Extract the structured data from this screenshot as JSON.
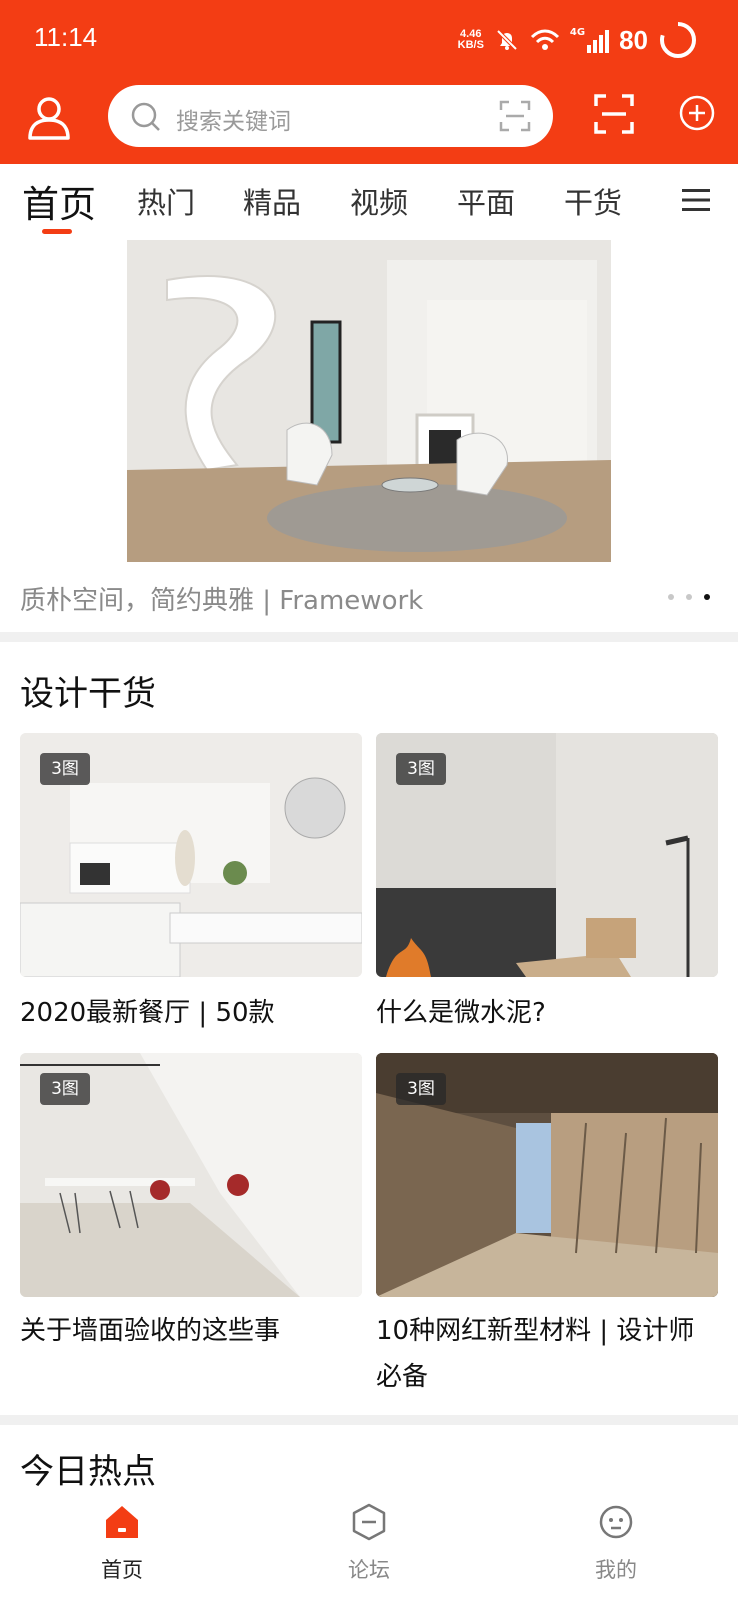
{
  "status_bar": {
    "time": "11:14",
    "speed_value": "4.46",
    "speed_unit": "KB/S",
    "network": "4G",
    "battery": "80"
  },
  "header": {
    "search_placeholder": "搜索关键词",
    "icons": [
      "user-icon",
      "search-icon",
      "scan-icon",
      "scan-icon",
      "add-icon"
    ]
  },
  "tabs": [
    {
      "label": "首页",
      "active": true
    },
    {
      "label": "热门"
    },
    {
      "label": "精品"
    },
    {
      "label": "视频"
    },
    {
      "label": "平面"
    },
    {
      "label": "干货"
    }
  ],
  "banner": {
    "caption": "质朴空间，简约典雅 | Framework",
    "dots": 3,
    "active_dot": 3
  },
  "design_section": {
    "title": "设计干货",
    "cards": [
      {
        "badge": "3图",
        "title": "2020最新餐厅 | 50款"
      },
      {
        "badge": "3图",
        "title": "什么是微水泥?"
      },
      {
        "badge": "3图",
        "title": "关于墙面验收的这些事"
      },
      {
        "badge": "3图",
        "title": "10种网红新型材料 | 设计师必备"
      }
    ]
  },
  "hot_section": {
    "title": "今日热点"
  },
  "bottom_nav": [
    {
      "label": "首页",
      "icon": "home-icon",
      "active": true
    },
    {
      "label": "论坛",
      "icon": "forum-icon"
    },
    {
      "label": "我的",
      "icon": "profile-icon"
    }
  ],
  "colors": {
    "brand": "#f33d14",
    "text": "#222222",
    "muted": "#8a8a8a"
  }
}
